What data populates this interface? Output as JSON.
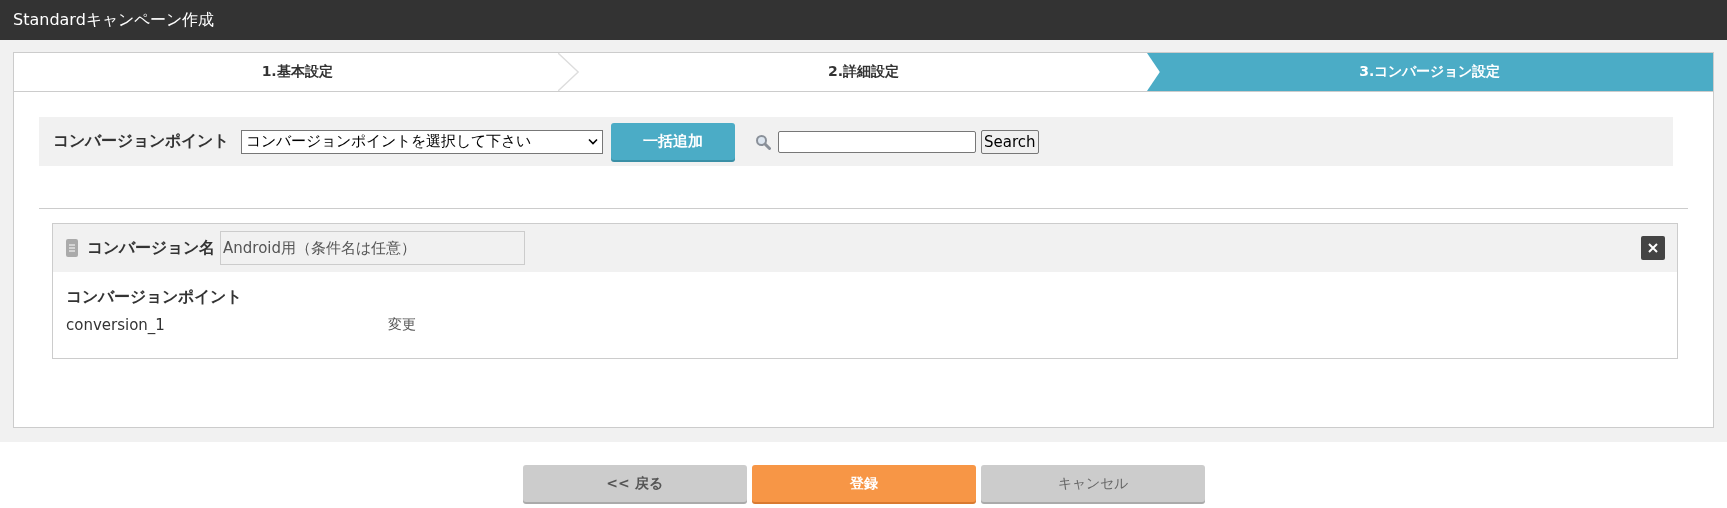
{
  "window": {
    "title": "Standardキャンペーン作成"
  },
  "steps": [
    {
      "label": "1.基本設定",
      "selected": false
    },
    {
      "label": "2.詳細設定",
      "selected": false
    },
    {
      "label": "3.コンバージョン設定",
      "selected": true
    }
  ],
  "toolbar": {
    "label": "コンバージョンポイント",
    "select_value": "コンバージョンポイントを選択して下さい",
    "add_button": "一括追加",
    "search_button": "Search"
  },
  "conversion": {
    "name_label": "コンバージョン名",
    "name_value": "Android用（条件名は任意）",
    "section_title": "コンバージョンポイント",
    "point": "conversion_1",
    "change_link": "変更"
  },
  "buttons": [
    {
      "label": "<< 戻る",
      "kind": "back"
    },
    {
      "label": "登録",
      "kind": "primary"
    },
    {
      "label": "キャンセル",
      "kind": "cancel"
    }
  ]
}
